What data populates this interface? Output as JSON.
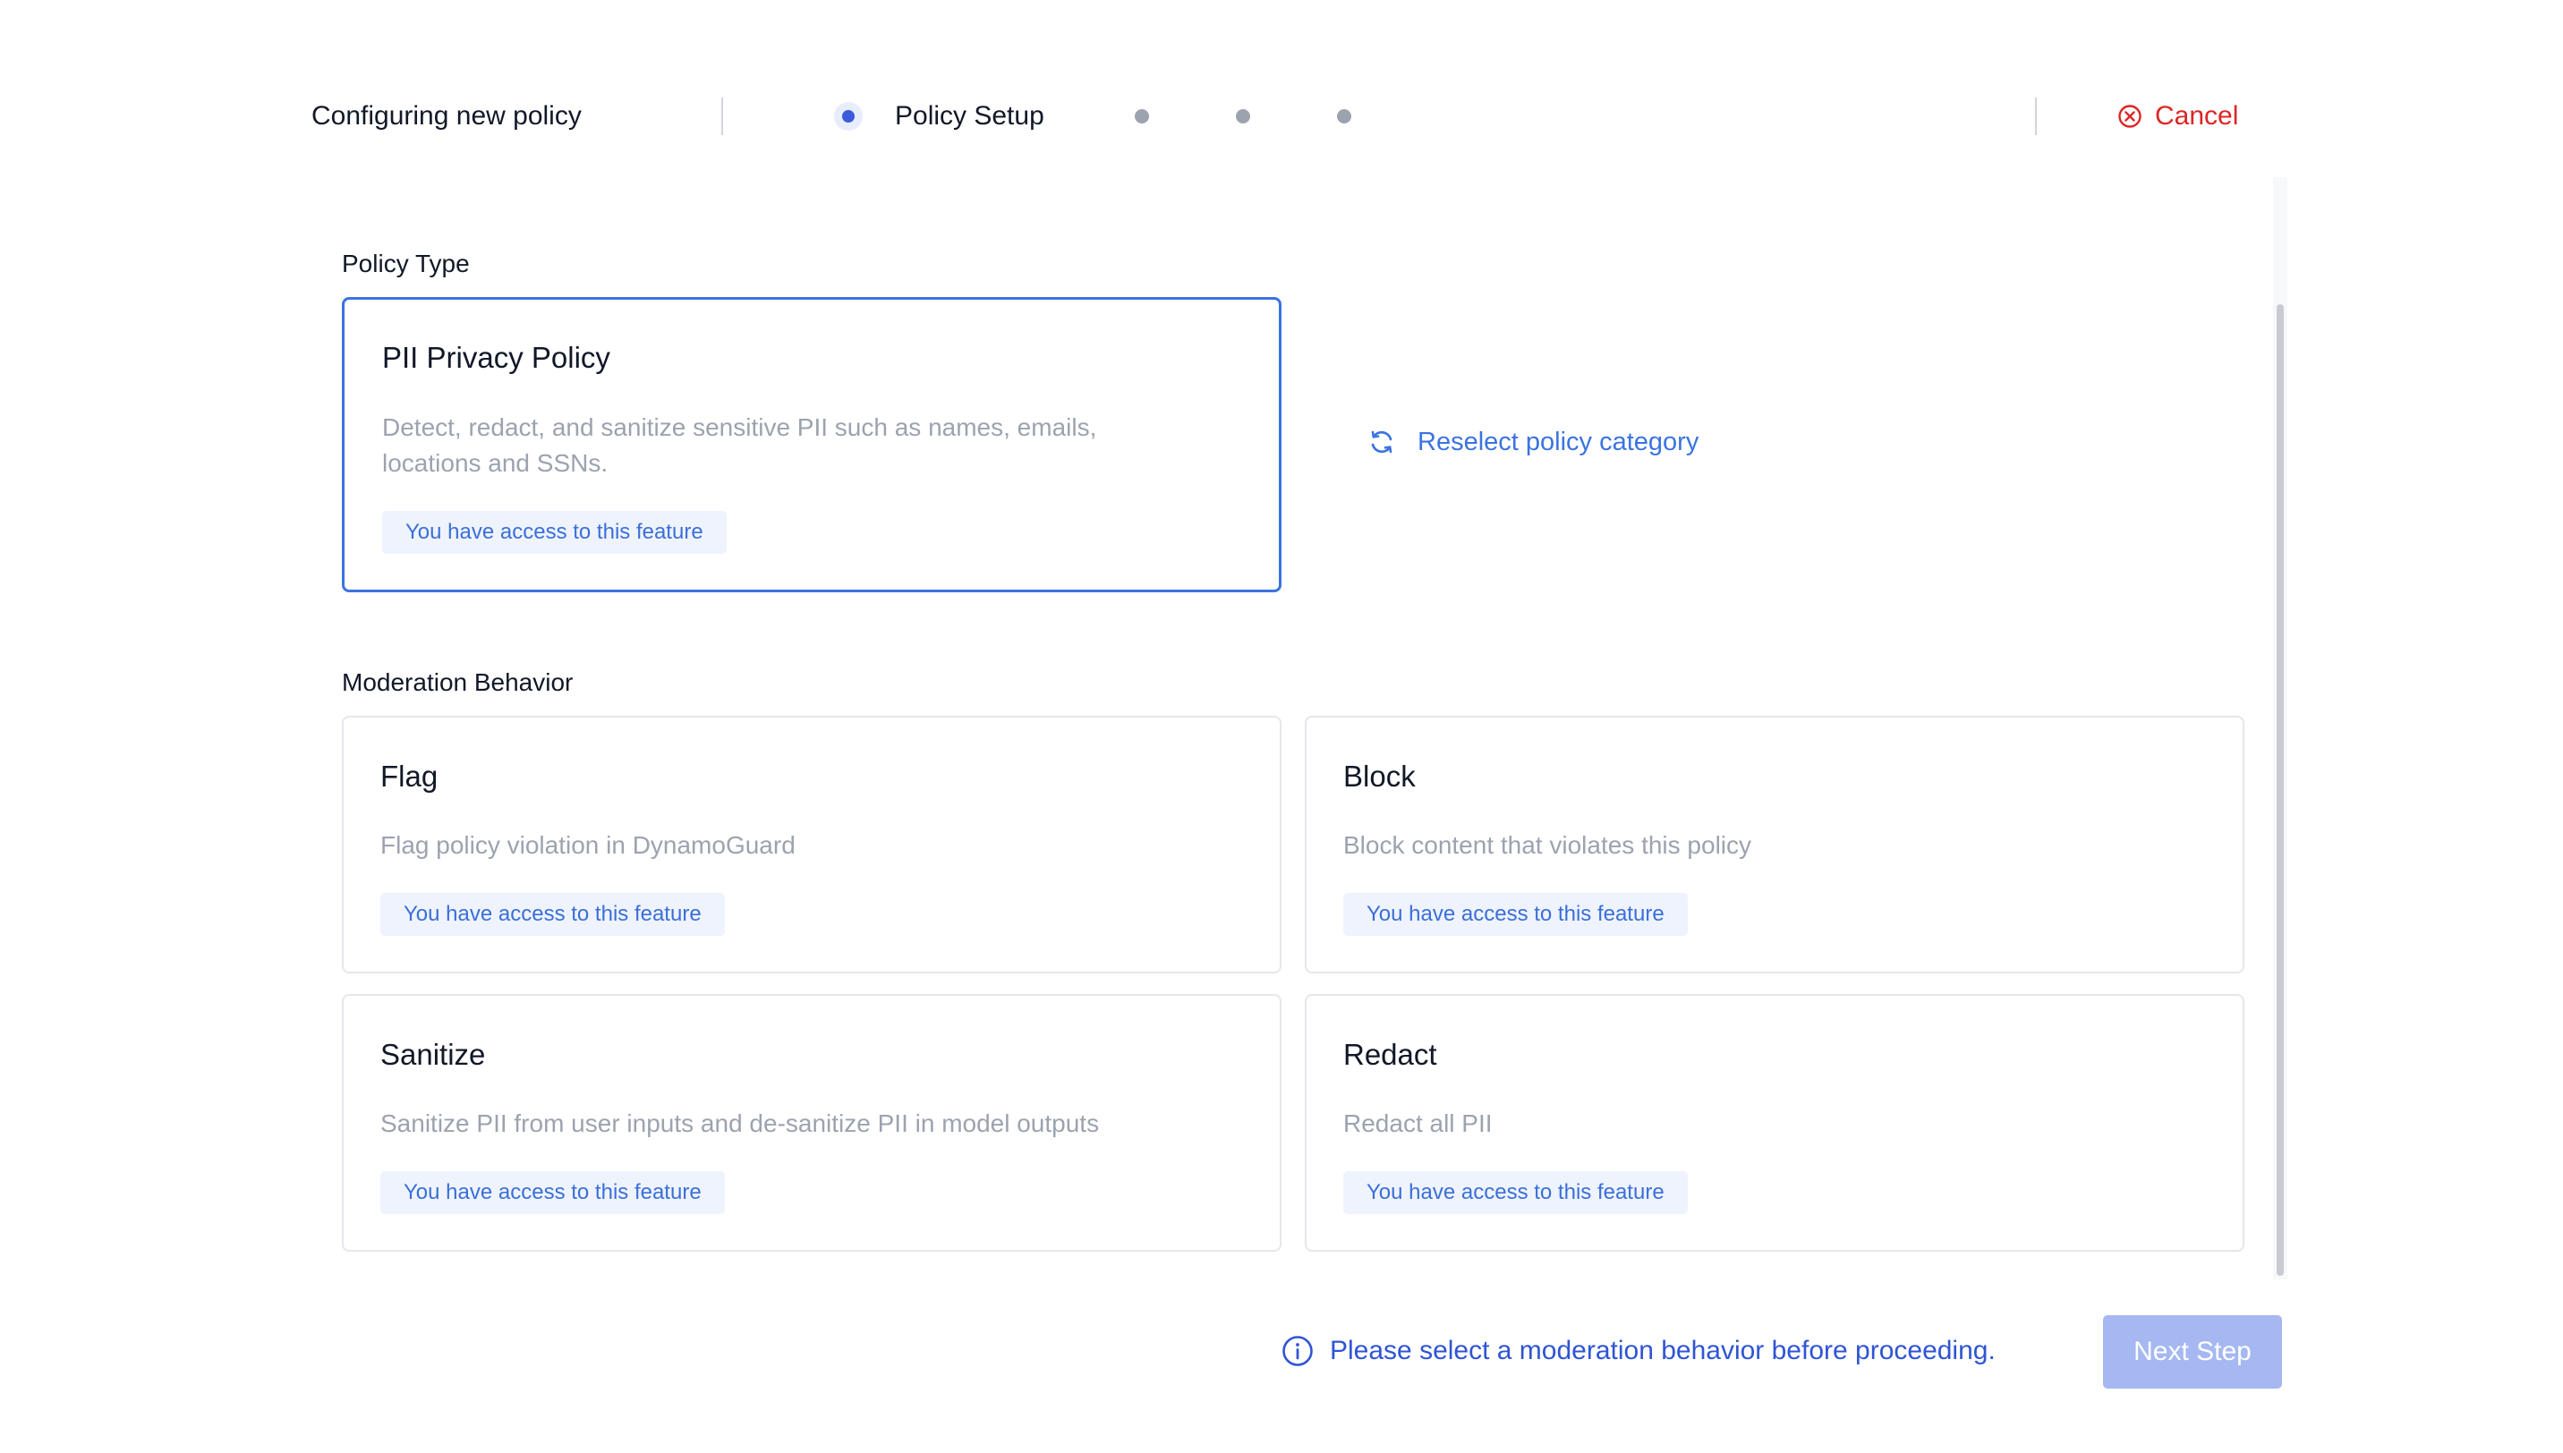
{
  "header": {
    "title": "Configuring new policy",
    "steps": [
      {
        "label": "Policy Setup",
        "active": true
      },
      {
        "label": "",
        "active": false
      },
      {
        "label": "",
        "active": false
      },
      {
        "label": "",
        "active": false
      }
    ],
    "cancel_label": "Cancel",
    "cancel_icon": "circle-x-icon"
  },
  "policy_type": {
    "section_label": "Policy Type",
    "card": {
      "title": "PII Privacy Policy",
      "description_line1": "Detect, redact, and sanitize sensitive PII such as names, emails,",
      "description_line2": "locations and SSNs.",
      "badge": "You have access to this feature"
    },
    "reselect_label": "Reselect policy category",
    "reselect_icon": "refresh-icon"
  },
  "moderation": {
    "section_label": "Moderation Behavior",
    "options": [
      {
        "title": "Flag",
        "description": "Flag policy violation in DynamoGuard",
        "badge": "You have access to this feature"
      },
      {
        "title": "Block",
        "description": "Block content that violates this policy",
        "badge": "You have access to this feature"
      },
      {
        "title": "Sanitize",
        "description": "Sanitize PII from user inputs and de-sanitize PII in model outputs",
        "badge": "You have access to this feature"
      },
      {
        "title": "Redact",
        "description": "Redact all PII",
        "badge": "You have access to this feature"
      }
    ]
  },
  "footer": {
    "info_icon": "info-icon",
    "info_text": "Please select a moderation behavior before proceeding.",
    "next_label": "Next Step"
  },
  "colors": {
    "accent": "#3b73e0",
    "danger": "#dc2626",
    "badge_bg": "#eef3fe",
    "disabled_button": "#a5b8f2"
  }
}
